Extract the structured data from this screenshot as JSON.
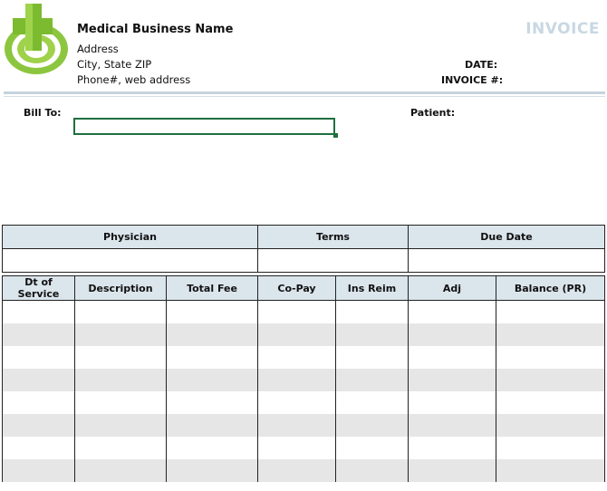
{
  "header": {
    "business_name": "Medical Business Name",
    "address": "Address",
    "city_state_zip": "City, State ZIP",
    "phone_web": "Phone#, web address",
    "title": "INVOICE",
    "date_label": "DATE:",
    "invoice_no_label": "INVOICE #:"
  },
  "billing": {
    "bill_to_label": "Bill To:",
    "patient_label": "Patient:"
  },
  "info_table": {
    "headers": [
      "Physician",
      "Terms",
      "Due Date"
    ]
  },
  "service_table": {
    "headers": [
      "Dt of Service",
      "Description",
      "Total Fee",
      "Co-Pay",
      "Ins Reim",
      "Adj",
      "Balance (PR)"
    ],
    "row_count": 8
  },
  "colors": {
    "logo_green": "#8cc63f",
    "header_fill": "#dbe5ec",
    "stripe": "#e6e6e6",
    "invoice_title": "#c8d8e3",
    "selection": "#1f6f3f"
  },
  "icons": {
    "logo": "medical-cross-logo-icon"
  }
}
